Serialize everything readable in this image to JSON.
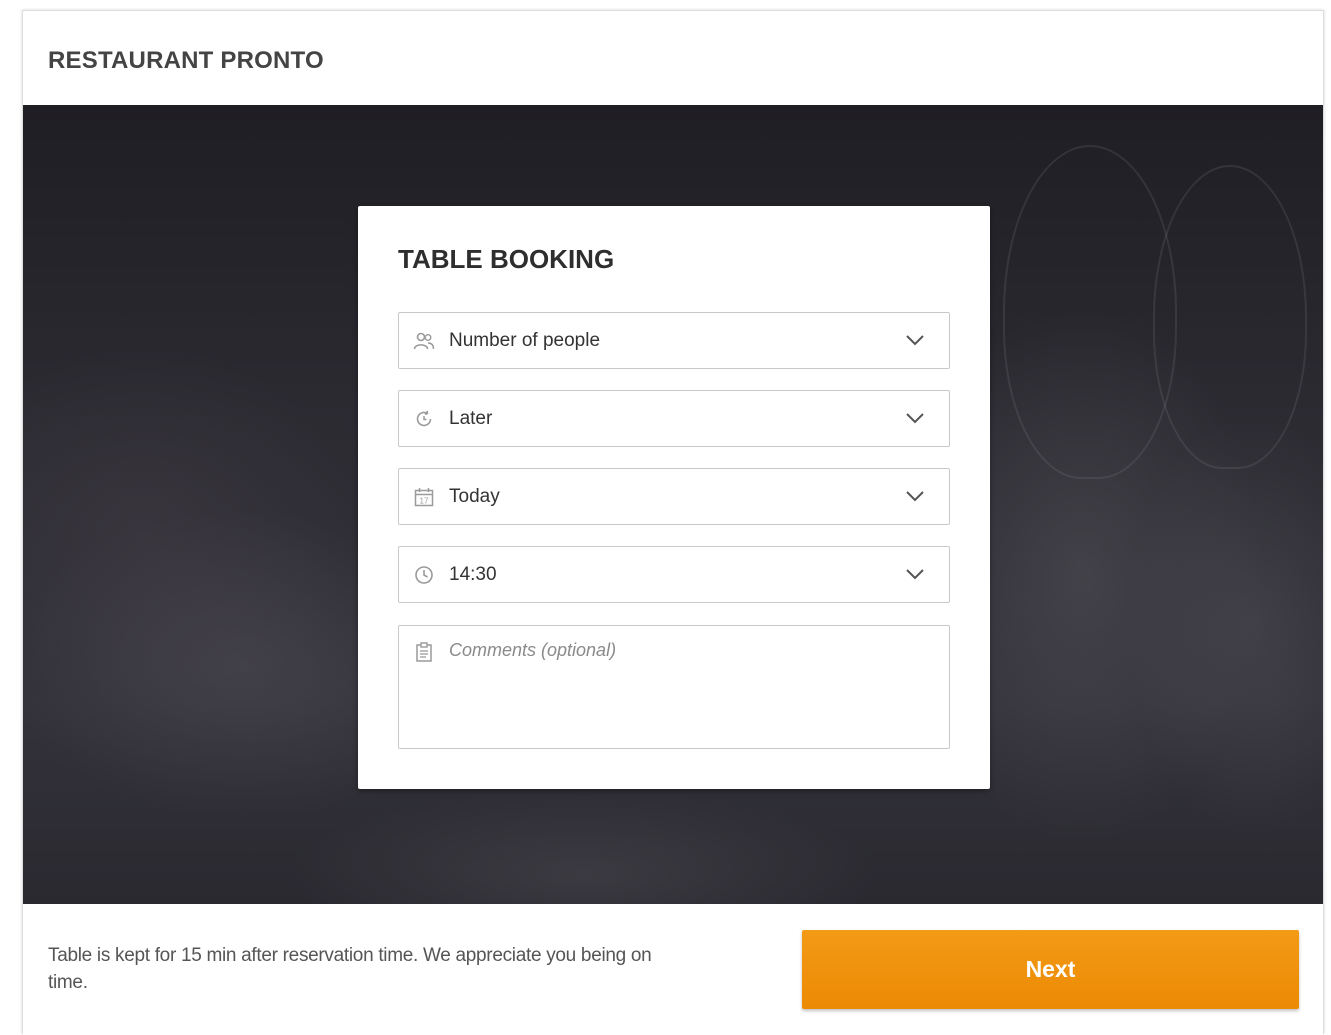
{
  "header": {
    "brand": "RESTAURANT PRONTO"
  },
  "booking": {
    "title": "TABLE BOOKING",
    "fields": [
      {
        "icon": "people-icon",
        "value": "Number of people"
      },
      {
        "icon": "timer-icon",
        "value": "Later"
      },
      {
        "icon": "calendar-icon",
        "value": "Today",
        "calendar_day": "17"
      },
      {
        "icon": "clock-icon",
        "value": "14:30"
      }
    ],
    "comments": {
      "icon": "clipboard-icon",
      "placeholder": "Comments (optional)"
    }
  },
  "footer": {
    "note": "Table is kept for 15 min after reservation time. We appreciate you being on time.",
    "next_label": "Next"
  },
  "colors": {
    "accent": "#f08f0c",
    "background_dark": "#2c2b32",
    "text": "#333333"
  }
}
